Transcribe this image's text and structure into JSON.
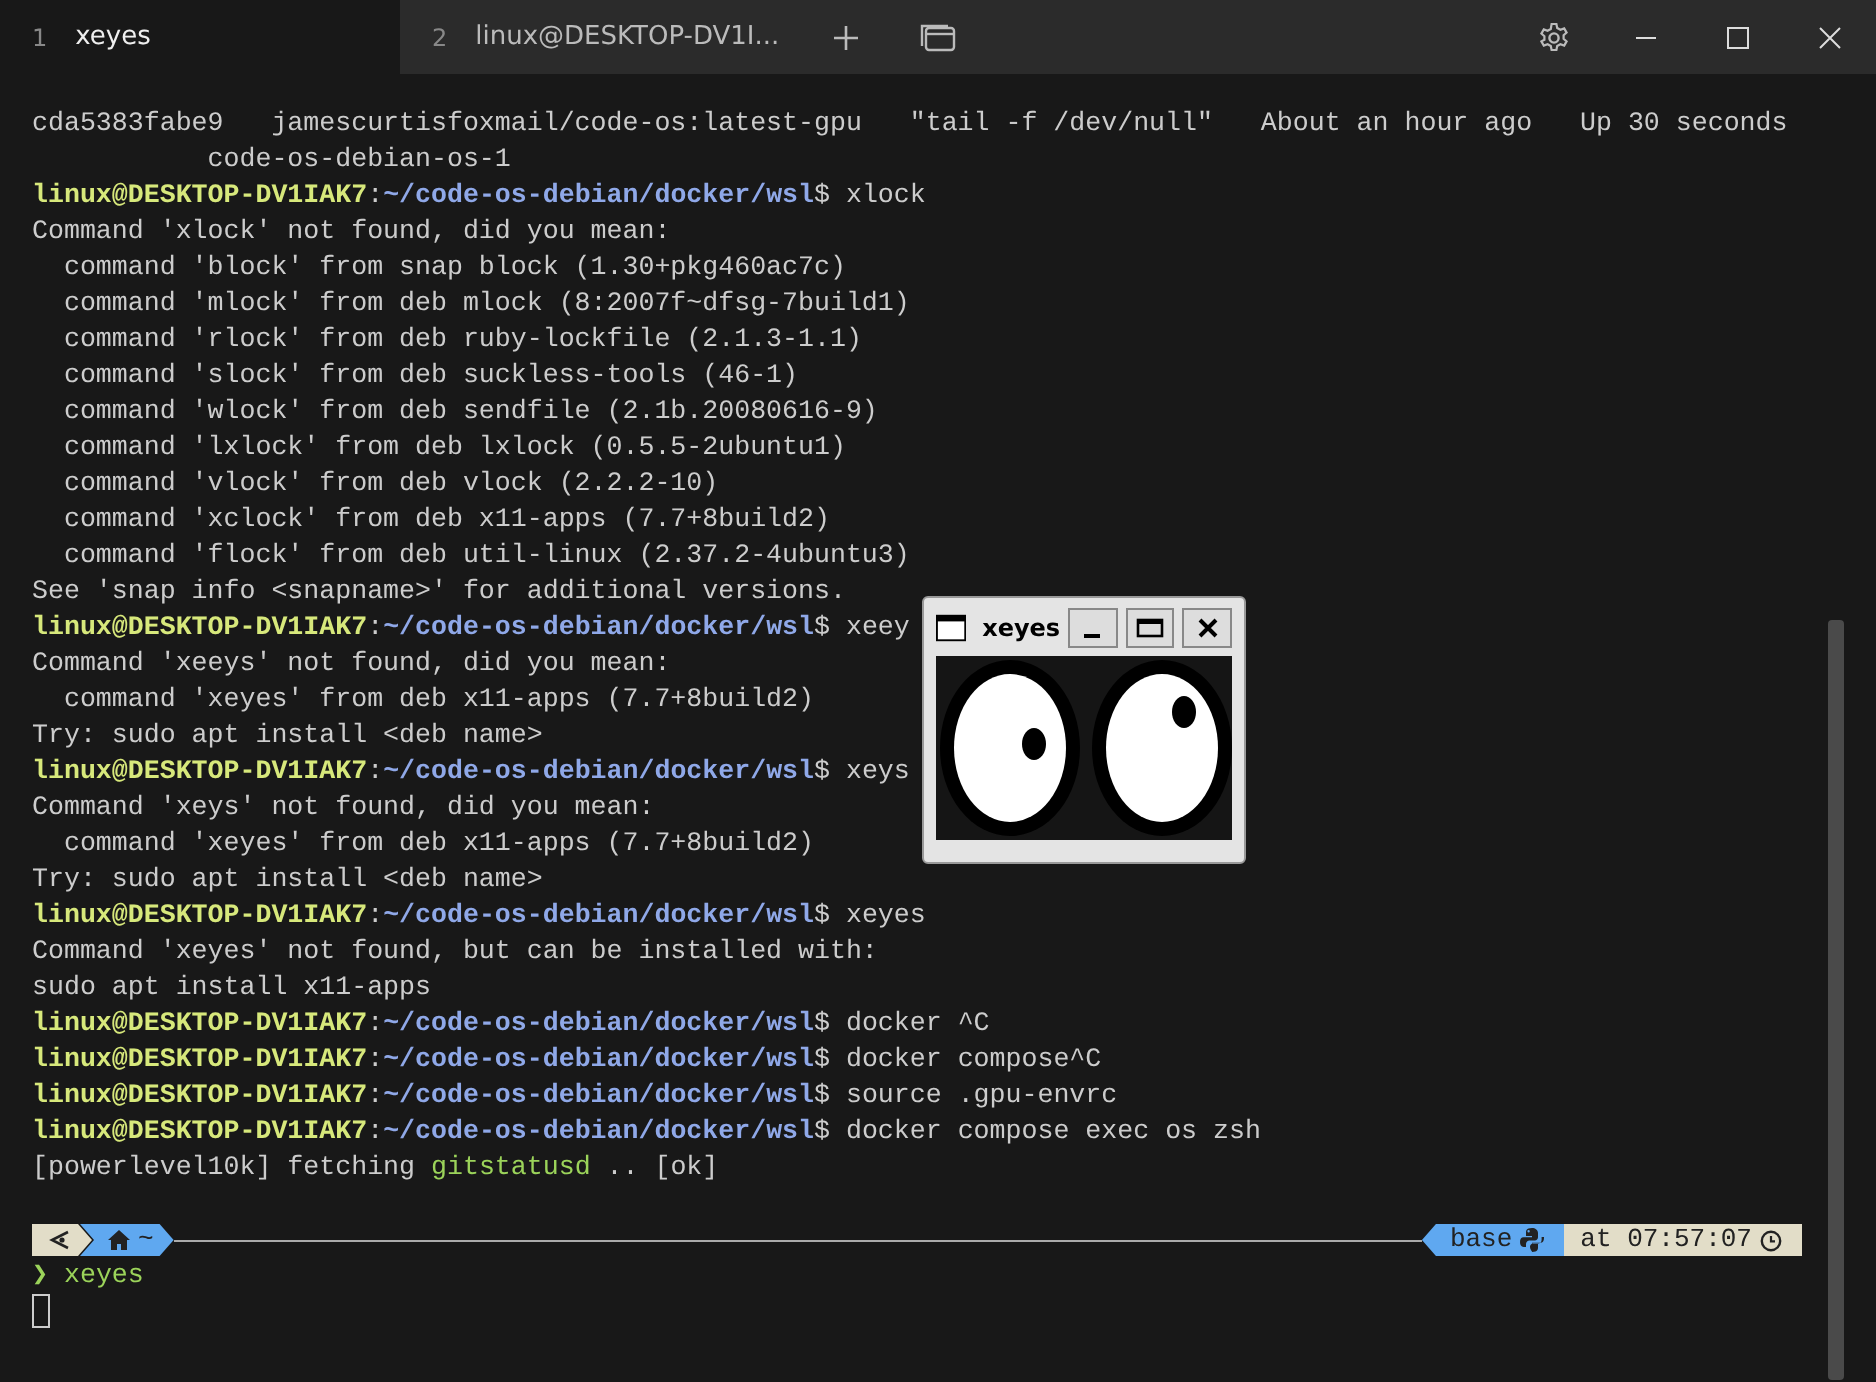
{
  "tabs": [
    {
      "number": "1",
      "title": "xeyes",
      "selected": true
    },
    {
      "number": "2",
      "title": "linux@DESKTOP-DV1I...",
      "selected": false
    }
  ],
  "lines": [
    {
      "kind": "output",
      "text": "cda5383fabe9   jamescurtisfoxmail/code-os:latest-gpu   \"tail -f /dev/null\"   About an hour ago   Up 30 seconds"
    },
    {
      "kind": "output",
      "text": "           code-os-debian-os-1"
    },
    {
      "kind": "prompt",
      "user": "linux@DESKTOP-DV1IAK7",
      "separator": ":",
      "path": "~/code-os-debian/docker/wsl",
      "symbol": "$",
      "command": "xlock"
    },
    {
      "kind": "output",
      "text": "Command 'xlock' not found, did you mean:"
    },
    {
      "kind": "output",
      "text": "  command 'block' from snap block (1.30+pkg460ac7c)"
    },
    {
      "kind": "output",
      "text": "  command 'mlock' from deb mlock (8:2007f~dfsg-7build1)"
    },
    {
      "kind": "output",
      "text": "  command 'rlock' from deb ruby-lockfile (2.1.3-1.1)"
    },
    {
      "kind": "output",
      "text": "  command 'slock' from deb suckless-tools (46-1)"
    },
    {
      "kind": "output",
      "text": "  command 'wlock' from deb sendfile (2.1b.20080616-9)"
    },
    {
      "kind": "output",
      "text": "  command 'lxlock' from deb lxlock (0.5.5-2ubuntu1)"
    },
    {
      "kind": "output",
      "text": "  command 'vlock' from deb vlock (2.2.2-10)"
    },
    {
      "kind": "output",
      "text": "  command 'xclock' from deb x11-apps (7.7+8build2)"
    },
    {
      "kind": "output",
      "text": "  command 'flock' from deb util-linux (2.37.2-4ubuntu3)"
    },
    {
      "kind": "output",
      "text": "See 'snap info <snapname>' for additional versions."
    },
    {
      "kind": "prompt",
      "user": "linux@DESKTOP-DV1IAK7",
      "separator": ":",
      "path": "~/code-os-debian/docker/wsl",
      "symbol": "$",
      "command": "xeey"
    },
    {
      "kind": "output",
      "text": "Command 'xeeys' not found, did you mean:"
    },
    {
      "kind": "output",
      "text": "  command 'xeyes' from deb x11-apps (7.7+8build2)"
    },
    {
      "kind": "output",
      "text": "Try: sudo apt install <deb name>"
    },
    {
      "kind": "prompt",
      "user": "linux@DESKTOP-DV1IAK7",
      "separator": ":",
      "path": "~/code-os-debian/docker/wsl",
      "symbol": "$",
      "command": "xeys"
    },
    {
      "kind": "output",
      "text": "Command 'xeys' not found, did you mean:"
    },
    {
      "kind": "output",
      "text": "  command 'xeyes' from deb x11-apps (7.7+8build2)"
    },
    {
      "kind": "output",
      "text": "Try: sudo apt install <deb name>"
    },
    {
      "kind": "prompt",
      "user": "linux@DESKTOP-DV1IAK7",
      "separator": ":",
      "path": "~/code-os-debian/docker/wsl",
      "symbol": "$",
      "command": "xeyes"
    },
    {
      "kind": "output",
      "text": "Command 'xeyes' not found, but can be installed with:"
    },
    {
      "kind": "output",
      "text": "sudo apt install x11-apps"
    },
    {
      "kind": "prompt",
      "user": "linux@DESKTOP-DV1IAK7",
      "separator": ":",
      "path": "~/code-os-debian/docker/wsl",
      "symbol": "$",
      "command": "docker ^C"
    },
    {
      "kind": "prompt",
      "user": "linux@DESKTOP-DV1IAK7",
      "separator": ":",
      "path": "~/code-os-debian/docker/wsl",
      "symbol": "$",
      "command": "docker compose^C"
    },
    {
      "kind": "prompt",
      "user": "linux@DESKTOP-DV1IAK7",
      "separator": ":",
      "path": "~/code-os-debian/docker/wsl",
      "symbol": "$",
      "command": "source .gpu-envrc"
    },
    {
      "kind": "prompt",
      "user": "linux@DESKTOP-DV1IAK7",
      "separator": ":",
      "path": "~/code-os-debian/docker/wsl",
      "symbol": "$",
      "command": "docker compose exec os zsh"
    },
    {
      "kind": "status",
      "before": "[powerlevel10k] fetching ",
      "highlight": "gitstatusd",
      "after": " .. [ok]"
    }
  ],
  "p10k": {
    "dir": "~",
    "env": "base",
    "time": "at 07:57:07"
  },
  "input": {
    "arrow": "❯",
    "command": "xeyes"
  },
  "xeyes_window": {
    "title": "xeyes"
  }
}
